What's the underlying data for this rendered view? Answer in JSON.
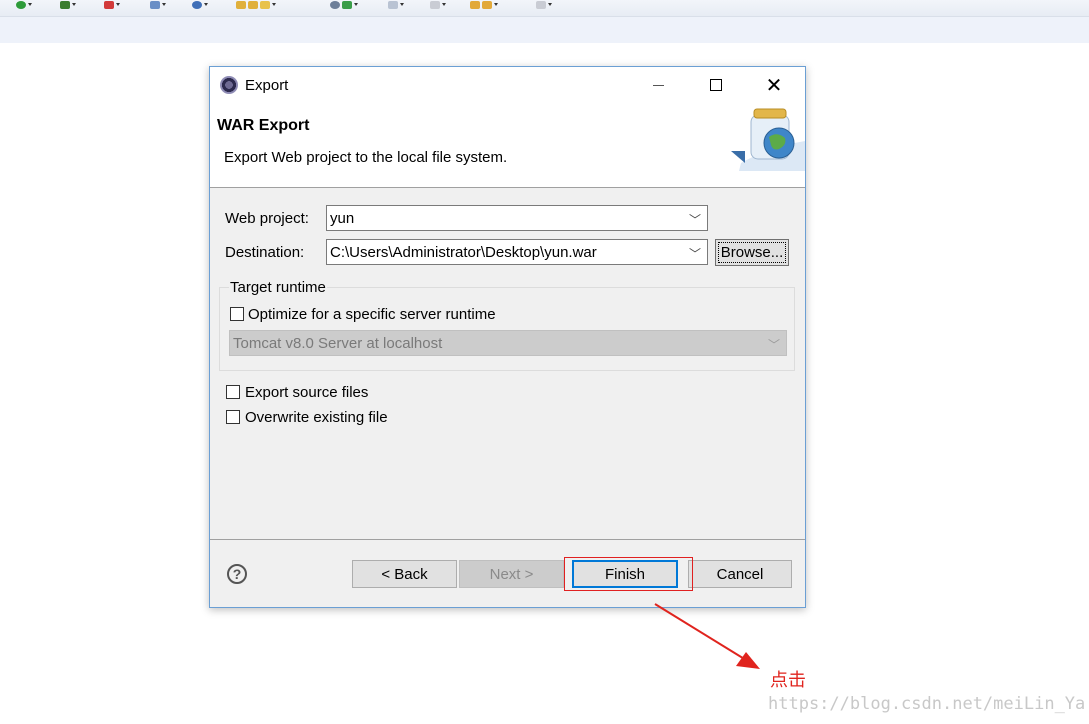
{
  "dialog": {
    "title": "Export",
    "close_glyph": "✕",
    "header_title": "WAR Export",
    "header_description": "Export Web project to the local file system.",
    "web_project_label": "Web project:",
    "web_project_value": "yun",
    "destination_label": "Destination:",
    "destination_value": "C:\\Users\\Administrator\\Desktop\\yun.war",
    "browse_label": "Browse...",
    "target_runtime_label": "Target runtime",
    "optimize_label": "Optimize for a specific server runtime",
    "optimize_checked": false,
    "runtime_value": "Tomcat v8.0 Server at localhost",
    "export_source_label": "Export source files",
    "export_source_checked": false,
    "overwrite_label": "Overwrite existing file",
    "overwrite_checked": false,
    "help_glyph": "?",
    "back_label": "< Back",
    "next_label": "Next >",
    "finish_label": "Finish",
    "cancel_label": "Cancel"
  },
  "annotation": {
    "text": "点击",
    "color": "#e0241e"
  },
  "watermark": {
    "text": "https://blog.csdn.net/meiLin_Ya"
  },
  "colors": {
    "dialog_border": "#6b9fd4",
    "finish_border": "#0078d7",
    "highlight_box": "#e02020"
  }
}
